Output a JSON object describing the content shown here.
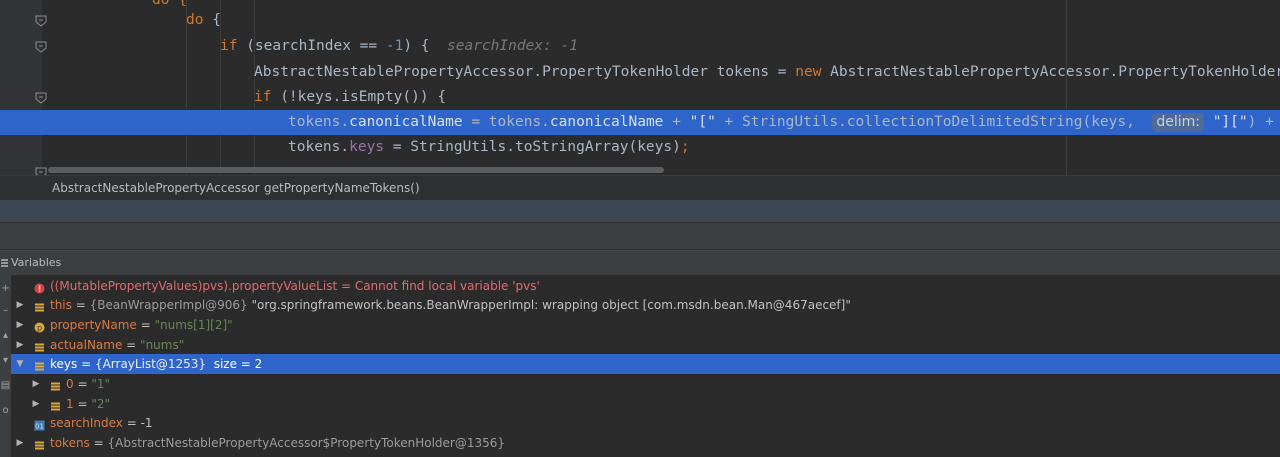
{
  "editor": {
    "lines": [
      {
        "id": "line-do-top",
        "tokens": [
          {
            "t": "do {",
            "c": "kw"
          }
        ]
      },
      {
        "id": "line-do",
        "tokens": [
          {
            "t": "do",
            "c": "kw"
          },
          {
            "t": " {",
            "c": ""
          }
        ]
      },
      {
        "id": "line-if-search",
        "tokens": [
          {
            "t": "if",
            "c": "kw"
          },
          {
            "t": " (searchIndex == ",
            "c": ""
          },
          {
            "t": "-1",
            "c": "num"
          },
          {
            "t": ") {  ",
            "c": ""
          },
          {
            "t": "searchIndex: -1",
            "c": "hint"
          }
        ]
      },
      {
        "id": "line-new-holder",
        "tokens": [
          {
            "t": "AbstractNestablePropertyAccessor.PropertyTokenHolder tokens = ",
            "c": ""
          },
          {
            "t": "new",
            "c": "kw"
          },
          {
            "t": " AbstractNestablePropertyAccessor.PropertyTokenHolder(act",
            "c": ""
          }
        ]
      },
      {
        "id": "line-if-keys",
        "tokens": [
          {
            "t": "if",
            "c": "kw"
          },
          {
            "t": " (!keys.isEmpty()) {",
            "c": ""
          }
        ]
      },
      {
        "id": "line-canonical",
        "tokens": [
          {
            "t": "tokens.",
            "c": ""
          },
          {
            "t": "canonicalName",
            "c": "fld"
          },
          {
            "t": " = tokens.",
            "c": ""
          },
          {
            "t": "canonicalName",
            "c": "fld"
          },
          {
            "t": " + ",
            "c": ""
          },
          {
            "t": "\"[\"",
            "c": "str"
          },
          {
            "t": " + StringUtils.collectionToDelimitedString(keys,  ",
            "c": ""
          },
          {
            "t": "delim:",
            "c": "param"
          },
          {
            "t": " ",
            "c": ""
          },
          {
            "t": "\"][\"",
            "c": "str"
          },
          {
            "t": ") + ",
            "c": ""
          },
          {
            "t": "\"]\"",
            "c": "str"
          },
          {
            "t": ";",
            "c": ""
          }
        ]
      },
      {
        "id": "line-keys",
        "tokens": [
          {
            "t": "tokens.",
            "c": ""
          },
          {
            "t": "keys",
            "c": "fld"
          },
          {
            "t": " = StringUtils.toStringArray(keys)",
            "c": ""
          },
          {
            "t": ";",
            "c": "kw"
          }
        ]
      }
    ]
  },
  "breadcrumb": {
    "class_name": "AbstractNestablePropertyAccessor",
    "separator": "›",
    "method_name": "getPropertyNameTokens()"
  },
  "variables": {
    "title": "Variables",
    "rows": [
      {
        "id": "var-pvs-error",
        "icon": "error-icon",
        "arrow": "",
        "parts": [
          {
            "t": "((MutablePropertyValues)pvs).propertyValueList = Cannot find local variable 'pvs'",
            "c": "verr"
          }
        ]
      },
      {
        "id": "var-this",
        "icon": "field-icon",
        "arrow": "▶",
        "parts": [
          {
            "t": "this",
            "c": "vname"
          },
          {
            "t": " = ",
            "c": "vnum"
          },
          {
            "t": "{BeanWrapperImpl@906}",
            "c": "vref"
          },
          {
            "t": " \"org.springframework.beans.BeanWrapperImpl: wrapping object [com.msdn.bean.Man@467aecef]\"",
            "c": "vnum"
          }
        ]
      },
      {
        "id": "var-propertyName",
        "icon": "param-icon",
        "arrow": "▶",
        "parts": [
          {
            "t": "propertyName",
            "c": "vname"
          },
          {
            "t": " = ",
            "c": "vnum"
          },
          {
            "t": "\"nums[1][2]\"",
            "c": "vstr"
          }
        ]
      },
      {
        "id": "var-actualName",
        "icon": "field-icon",
        "arrow": "▶",
        "parts": [
          {
            "t": "actualName",
            "c": "vname"
          },
          {
            "t": " = ",
            "c": "vnum"
          },
          {
            "t": "\"nums\"",
            "c": "vstr"
          }
        ]
      },
      {
        "id": "var-keys",
        "icon": "field-icon",
        "arrow": "▼",
        "selected": true,
        "parts": [
          {
            "t": "keys",
            "c": "vname"
          },
          {
            "t": " = ",
            "c": "vnum"
          },
          {
            "t": "{ArrayList@1253}",
            "c": "vref"
          },
          {
            "t": "  size = 2",
            "c": "vnum"
          }
        ]
      },
      {
        "id": "var-keys-0",
        "icon": "field-icon",
        "arrow": "▶",
        "child": true,
        "parts": [
          {
            "t": "0",
            "c": "vname"
          },
          {
            "t": " = ",
            "c": "vnum"
          },
          {
            "t": "\"1\"",
            "c": "vstr"
          }
        ]
      },
      {
        "id": "var-keys-1",
        "icon": "field-icon",
        "arrow": "▶",
        "child": true,
        "parts": [
          {
            "t": "1",
            "c": "vname"
          },
          {
            "t": " = ",
            "c": "vnum"
          },
          {
            "t": "\"2\"",
            "c": "vstr"
          }
        ]
      },
      {
        "id": "var-searchIndex",
        "icon": "primitive-icon",
        "arrow": "",
        "parts": [
          {
            "t": "searchIndex",
            "c": "vname"
          },
          {
            "t": " = ",
            "c": "vnum"
          },
          {
            "t": "-1",
            "c": "vnum"
          }
        ]
      },
      {
        "id": "var-tokens",
        "icon": "field-icon",
        "arrow": "▶",
        "parts": [
          {
            "t": "tokens",
            "c": "vname"
          },
          {
            "t": " = ",
            "c": "vnum"
          },
          {
            "t": "{AbstractNestablePropertyAccessor$PropertyTokenHolder@1356}",
            "c": "vref"
          }
        ]
      }
    ]
  },
  "toolbar": {
    "icons": [
      "add-icon",
      "minus-icon",
      "up-icon",
      "down-icon",
      "copy-icon",
      "glasses-icon"
    ]
  },
  "colors": {
    "selection": "#2f65ca",
    "editor_bg": "#2b2b2b",
    "panel_bg": "#3c3f41",
    "keyword": "#cc7832",
    "field": "#9876aa",
    "string": "#6a8759"
  }
}
